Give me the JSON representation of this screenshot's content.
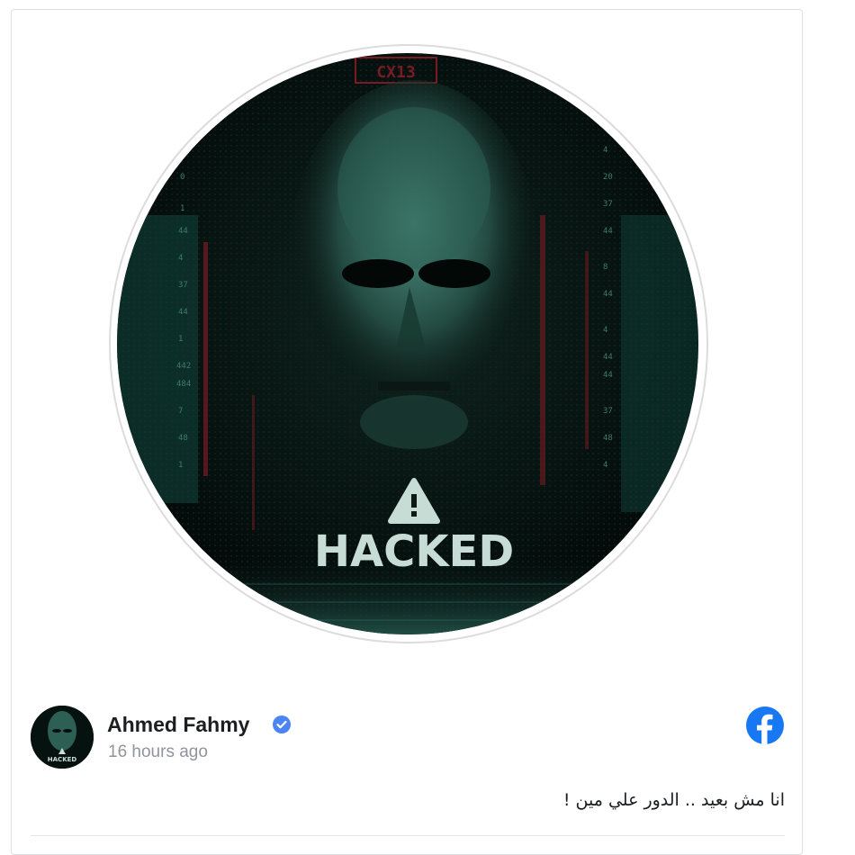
{
  "post": {
    "image": {
      "banner_text": "HACKED",
      "top_code": "CX13",
      "warning_icon": "warning-triangle-icon",
      "colors": {
        "background": "#050a0a",
        "teal": "#5fb0a0",
        "red_accent": "#7a1a22",
        "text": "#c8dcd6"
      }
    },
    "author": {
      "name": "Ahmed Fahmy",
      "verified_icon": "verified-badge-icon",
      "timestamp": "16 hours ago",
      "avatar_text": "HACKED"
    },
    "platform_icon": "facebook-icon",
    "text": "انا مش بعيد .. الدور علي مين !",
    "colors": {
      "facebook_blue": "#1877f2",
      "verified_blue": "#4b84f4"
    }
  }
}
